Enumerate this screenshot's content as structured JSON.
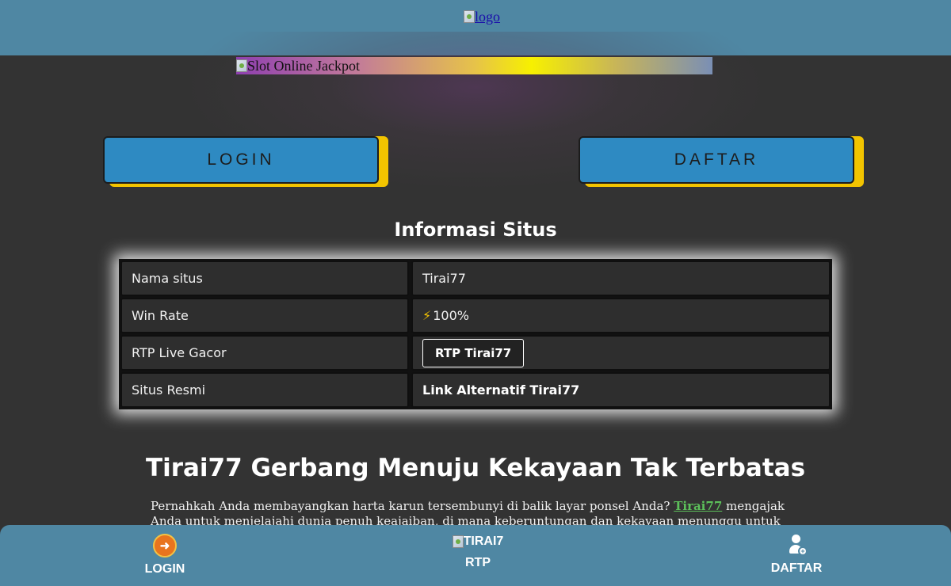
{
  "header": {
    "logo_alt": "logo"
  },
  "banner": {
    "alt": "Slot Online Jackpot"
  },
  "buttons": {
    "login": "LOGIN",
    "daftar": "DAFTAR"
  },
  "info": {
    "title": "Informasi Situs",
    "rows": [
      {
        "label": "Nama situs",
        "value": "Tirai77"
      },
      {
        "label": "Win Rate",
        "value": "100%"
      },
      {
        "label": "RTP Live Gacor",
        "value": "RTP Tirai77"
      },
      {
        "label": "Situs Resmi",
        "value": "Link Alternatif Tirai77"
      }
    ],
    "bolt_icon": "⚡"
  },
  "article": {
    "heading": "Tirai77 Gerbang Menuju Kekayaan Tak Terbatas",
    "para_before": "Pernahkah Anda membayangkan harta karun tersembunyi di balik layar ponsel Anda? ",
    "para_link": "Tirai77",
    "para_after": " mengajak Anda untuk menjelajahi dunia penuh keajaiban, di mana keberuntungan dan kekayaan menunggu untuk diraih. Sebagai"
  },
  "bottom_nav": {
    "login": "LOGIN",
    "rtp_img_alt": "TIRAI7",
    "rtp": "RTP",
    "daftar": "DAFTAR"
  },
  "colors": {
    "header_bg": "#4f87a3",
    "page_bg": "#333333",
    "button_bg": "#2e8ac2",
    "button_shadow": "#f2c400",
    "link_green": "#5cc05a"
  }
}
